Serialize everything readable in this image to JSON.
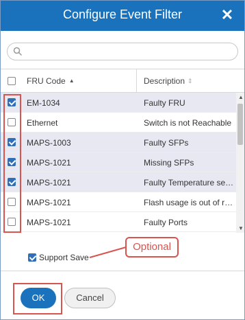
{
  "dialog": {
    "title": "Configure Event Filter",
    "close_icon": "close-icon"
  },
  "search": {
    "placeholder": "",
    "value": "",
    "icon": "search-icon"
  },
  "table": {
    "columns": [
      {
        "label": "FRU Code",
        "sort": "ascending"
      },
      {
        "label": "Description",
        "sort": "none"
      }
    ],
    "header_checked": false,
    "rows": [
      {
        "checked": true,
        "fru": "EM-1034",
        "description": "Faulty FRU"
      },
      {
        "checked": false,
        "fru": "Ethernet",
        "description": "Switch is not Reachable"
      },
      {
        "checked": true,
        "fru": "MAPS-1003",
        "description": "Faulty SFPs"
      },
      {
        "checked": true,
        "fru": "MAPS-1021",
        "description": "Missing SFPs"
      },
      {
        "checked": true,
        "fru": "MAPS-1021",
        "description": "Faulty Temperature sen..."
      },
      {
        "checked": false,
        "fru": "MAPS-1021",
        "description": "Flash usage is out of ran..."
      },
      {
        "checked": false,
        "fru": "MAPS-1021",
        "description": "Faulty Ports"
      }
    ]
  },
  "support_save": {
    "label": "Support Save",
    "checked": true
  },
  "annotation": {
    "callout_text": "Optional"
  },
  "footer": {
    "ok_label": "OK",
    "cancel_label": "Cancel"
  },
  "colors": {
    "accent": "#1a72bd",
    "annotation": "#d9534f",
    "selected_row": "#e8e8f3"
  }
}
